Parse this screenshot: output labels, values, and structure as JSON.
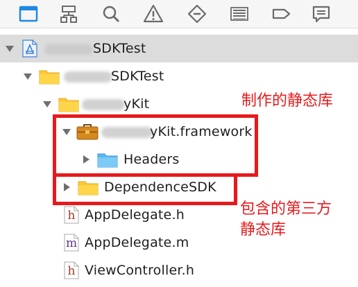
{
  "toolbar": {
    "items": [
      {
        "name": "folder-icon"
      },
      {
        "name": "hierarchy-icon"
      },
      {
        "name": "search-icon"
      },
      {
        "name": "warning-icon"
      },
      {
        "name": "diamond-icon"
      },
      {
        "name": "list-icon"
      },
      {
        "name": "tag-icon"
      },
      {
        "name": "comment-icon"
      }
    ]
  },
  "tree": {
    "project": "SDKTest",
    "group": "SDKTest",
    "kit_folder": "yKit",
    "framework": "yKit.framework",
    "headers": "Headers",
    "dependence": "DependenceSDK",
    "files": [
      "AppDelegate.h",
      "AppDelegate.m",
      "ViewController.h"
    ]
  },
  "annotations": {
    "note1": "制作的静态库",
    "note2_line1": "包含的第三方",
    "note2_line2": "静态库"
  },
  "colors": {
    "accent": "#1e88e5",
    "annotation": "#e8191c",
    "folder": "#ffc934",
    "selection": "#dcdcdc"
  }
}
